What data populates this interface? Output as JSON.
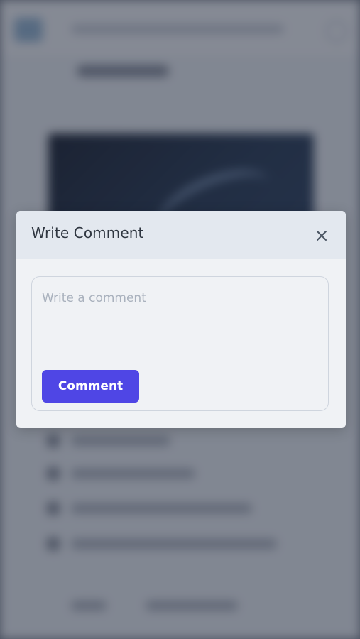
{
  "modal": {
    "title": "Write Comment",
    "close_icon": "close-icon",
    "comment_placeholder": "Write a comment",
    "comment_value": "",
    "submit_label": "Comment"
  },
  "colors": {
    "primary_button": "#4f46e5",
    "modal_header": "#e3e8ef",
    "modal_body": "#f0f2f5",
    "overlay": "#6b7280"
  }
}
